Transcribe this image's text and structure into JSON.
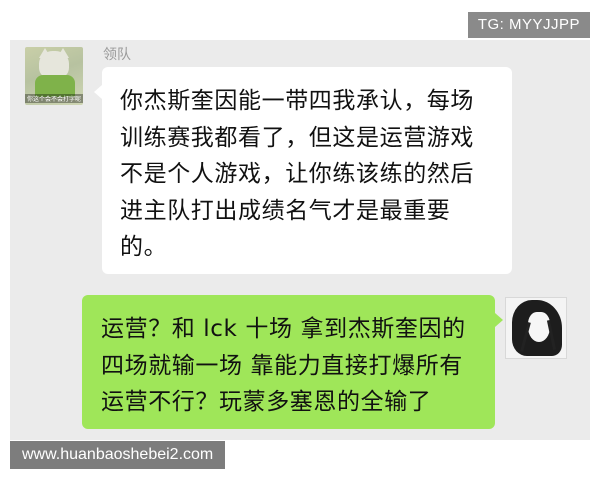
{
  "watermark_top": "TG: MYYJJPP",
  "watermark_bottom": "www.huanbaoshebei2.com",
  "messages": [
    {
      "sender": "领队",
      "avatar_caption": "你这个会不会打字呢",
      "lines": [
        "你杰斯奎因能一带四我承认，每场",
        "训练赛我都看了，但这是运营游戏",
        "不是个人游戏，让你练该练的然后",
        "进主队打出成绩名气才是最重要",
        "的。"
      ]
    },
    {
      "lines": [
        "运营？和 lck 十场 拿到杰斯奎因的",
        "四场就输一场 靠能力直接打爆所有",
        "运营不行？玩蒙多塞恩的全输了"
      ]
    }
  ],
  "colors": {
    "chat_background": "#ebebeb",
    "incoming_bubble": "#ffffff",
    "outgoing_bubble": "#9fe659"
  },
  "icons": {
    "left_avatar": "cat-avatar-icon",
    "right_avatar": "anime-avatar-icon"
  }
}
